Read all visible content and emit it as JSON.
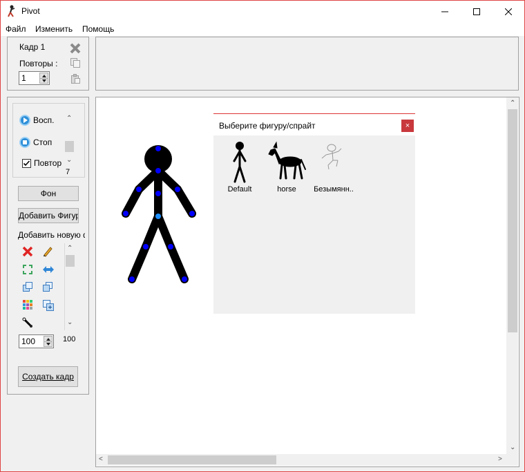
{
  "window": {
    "title": "Pivot"
  },
  "menu": {
    "items": [
      "Файл",
      "Изменить",
      "Помощь"
    ]
  },
  "frame_panel": {
    "frame_label": "Кадр 1",
    "repeats_label": "Повторы :",
    "repeats_value": "1"
  },
  "playback": {
    "play_label": "Восп.",
    "stop_label": "Стоп",
    "loop_label": "Повтор",
    "speed_value": "7",
    "loop_checked": true
  },
  "buttons": {
    "background": "Фон",
    "add_figure": "Добавить Фигуру",
    "create_frame": "Создать кадр"
  },
  "add_new": {
    "label": "Добавить новую ф"
  },
  "scale": {
    "value": "100",
    "label": "100"
  },
  "dialog": {
    "title": "Выберите фигуру/спрайт",
    "close_glyph": "×",
    "sprites": [
      {
        "label": "Default",
        "icon": "stickman-icon"
      },
      {
        "label": "horse",
        "icon": "horse-icon"
      },
      {
        "label": "Безымянн..",
        "icon": "unnamed-stick-figure-icon"
      }
    ]
  },
  "colors": {
    "accent_border": "#e04343",
    "joint": "#0000ff",
    "figure": "#000000"
  }
}
